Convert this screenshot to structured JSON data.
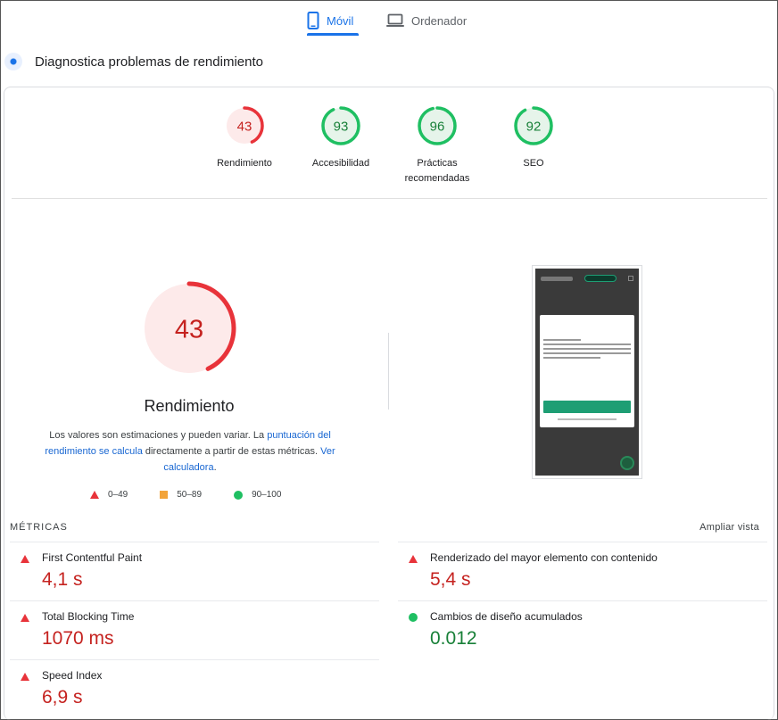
{
  "tabs": [
    {
      "label": "Móvil",
      "icon": "phone-icon",
      "active": true
    },
    {
      "label": "Ordenador",
      "icon": "laptop-icon",
      "active": false
    }
  ],
  "diagnose": {
    "title": "Diagnostica problemas de rendimiento"
  },
  "categories": [
    {
      "score": 43,
      "label": "Rendimiento",
      "status": "fail"
    },
    {
      "score": 93,
      "label": "Accesibilidad",
      "status": "pass"
    },
    {
      "score": 96,
      "label": "Prácticas recomendadas",
      "status": "pass"
    },
    {
      "score": 92,
      "label": "SEO",
      "status": "pass"
    }
  ],
  "performance": {
    "score": 43,
    "title": "Rendimiento",
    "description_prefix": "Los valores son estimaciones y pueden variar. La ",
    "link1": "puntuación del rendimiento se calcula",
    "description_mid": " directamente a partir de estas métricas. ",
    "link2": "Ver calculadora",
    "description_suffix": "."
  },
  "legend": [
    {
      "shape": "triangle",
      "range": "0–49",
      "color": "#e8333a"
    },
    {
      "shape": "square",
      "range": "50–89",
      "color": "#f2a43a"
    },
    {
      "shape": "circle",
      "range": "90–100",
      "color": "#1fbf62"
    }
  ],
  "colors": {
    "fail": "#e8333a",
    "fail_bg": "#fdeaea",
    "pass": "#1fbf62",
    "pass_bg": "#e6f4ea",
    "fail_text": "#c5221f",
    "pass_text": "#188038",
    "accent": "#1a73e8"
  },
  "metrics_header": "MÉTRICAS",
  "expand_view": "Ampliar vista",
  "metrics": [
    {
      "name": "First Contentful Paint",
      "value": "4,1 s",
      "status": "fail"
    },
    {
      "name": "Renderizado del mayor elemento con contenido",
      "value": "5,4 s",
      "status": "fail"
    },
    {
      "name": "Total Blocking Time",
      "value": "1070 ms",
      "status": "fail"
    },
    {
      "name": "Cambios de diseño acumulados",
      "value": "0.012",
      "status": "pass"
    },
    {
      "name": "Speed Index",
      "value": "6,9 s",
      "status": "fail"
    }
  ]
}
